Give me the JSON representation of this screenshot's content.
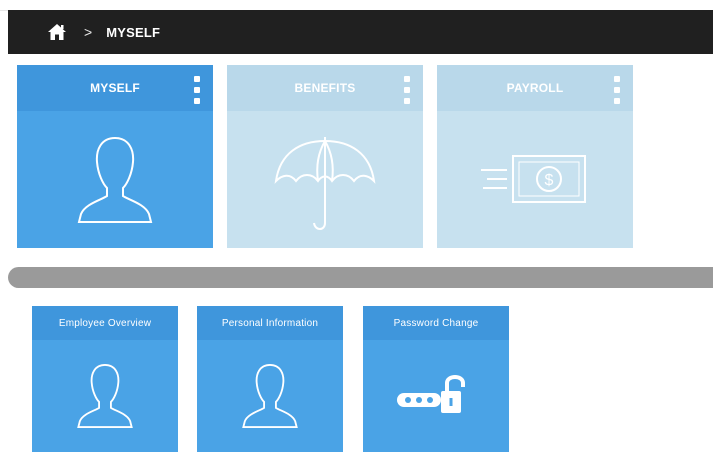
{
  "breadcrumb": {
    "home_icon": "home-icon",
    "separator": ">",
    "current": "MYSELF"
  },
  "tiles": [
    {
      "label": "MYSELF",
      "icon": "person-icon",
      "state": "active"
    },
    {
      "label": "BENEFITS",
      "icon": "umbrella-icon",
      "state": "inactive"
    },
    {
      "label": "PAYROLL",
      "icon": "money-icon",
      "state": "inactive"
    }
  ],
  "subtiles": [
    {
      "label": "Employee Overview",
      "icon": "person-icon"
    },
    {
      "label": "Personal Information",
      "icon": "person-icon"
    },
    {
      "label": "Password Change",
      "icon": "password-lock-icon"
    }
  ],
  "colors": {
    "active_tile": "#4aa3e6",
    "inactive_tile": "#c7e1ef",
    "breadcrumb_bar": "#202020",
    "divider": "#9a9a9a"
  }
}
